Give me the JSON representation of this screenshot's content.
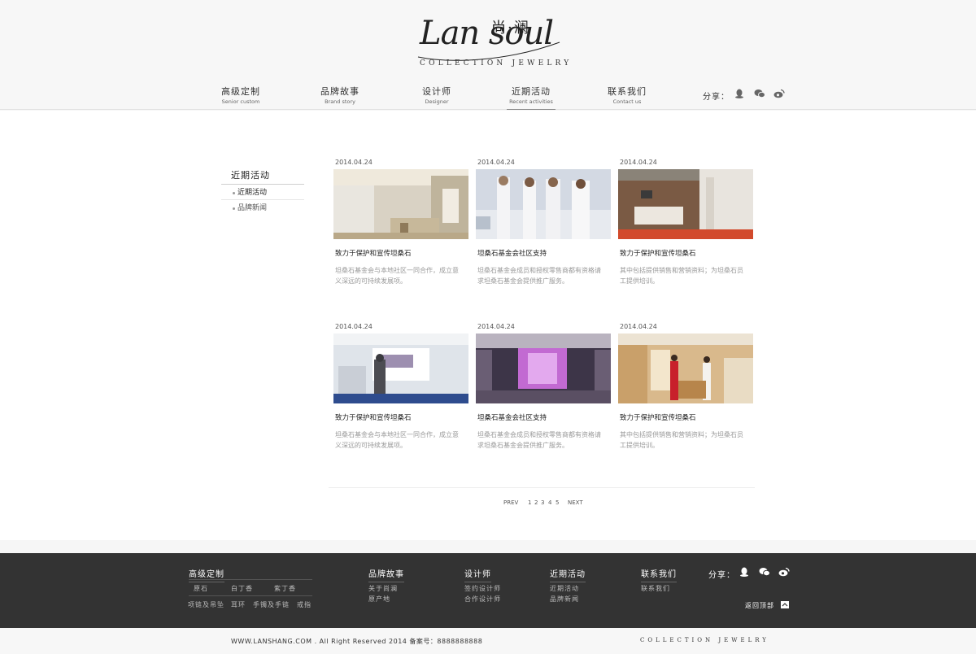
{
  "brand": {
    "script": "Lan soul",
    "cn": "尚·澜",
    "tagline": "COLLECTION   JEWELRY"
  },
  "nav": [
    {
      "cn": "高级定制",
      "en": "Senior custom"
    },
    {
      "cn": "品牌故事",
      "en": "Brand story"
    },
    {
      "cn": "设计师",
      "en": "Designer"
    },
    {
      "cn": "近期活动",
      "en": "Recent activities"
    },
    {
      "cn": "联系我们",
      "en": "Contact us"
    }
  ],
  "share_label": "分享：",
  "sidebar": {
    "title": "近期活动",
    "items": [
      "近期活动",
      "品牌新闻"
    ]
  },
  "cards": [
    {
      "date": "2014.04.24",
      "title": "致力于保护和宣传坦桑石",
      "desc": "坦桑石基金会与本地社区一同合作，成立意义深远的可持续发展项。"
    },
    {
      "date": "2014.04.24",
      "title": "坦桑石基金会社区支持",
      "desc": "坦桑石基金会成员和授权零售商都有资格请求坦桑石基金会提供推广服务。"
    },
    {
      "date": "2014.04.24",
      "title": "致力于保护和宣传坦桑石",
      "desc": "其中包括提供销售和营销资料；为坦桑石员工提供培训。"
    },
    {
      "date": "2014.04.24",
      "title": "致力于保护和宣传坦桑石",
      "desc": "坦桑石基金会与本地社区一同合作，成立意义深远的可持续发展项。"
    },
    {
      "date": "2014.04.24",
      "title": "坦桑石基金会社区支持",
      "desc": "坦桑石基金会成员和授权零售商都有资格请求坦桑石基金会提供推广服务。"
    },
    {
      "date": "2014.04.24",
      "title": "致力于保护和宣传坦桑石",
      "desc": "其中包括提供销售和营销资料；为坦桑石员工提供培训。"
    }
  ],
  "pager": {
    "prev": "PREV",
    "pages": [
      "1",
      "2",
      "3",
      "4",
      "5"
    ],
    "next": "NEXT"
  },
  "footer": {
    "col1": {
      "title": "高级定制",
      "row1": [
        "原石",
        "白丁香",
        "紫丁香"
      ],
      "row2": [
        "项链及吊坠",
        "耳环",
        "手镯及手链",
        "戒指"
      ]
    },
    "col2": {
      "title": "品牌故事",
      "links": [
        "关于尚澜",
        "原产地"
      ]
    },
    "col3": {
      "title": "设计师",
      "links": [
        "签约设计师",
        "合作设计师"
      ]
    },
    "col4": {
      "title": "近期活动",
      "links": [
        "近期活动",
        "品牌新闻"
      ]
    },
    "col5": {
      "title": "联系我们",
      "links": [
        "联系我们"
      ]
    },
    "share_label": "分享：",
    "back_top": "返回顶部"
  },
  "copyright": "WWW.LANSHANG.COM . All Right Reserved 2014    备案号：8888888888",
  "bottom_tag": "COLLECTION   JEWELRY",
  "icons": [
    "qq-icon",
    "wechat-icon",
    "weibo-icon",
    "back-to-top-icon"
  ]
}
